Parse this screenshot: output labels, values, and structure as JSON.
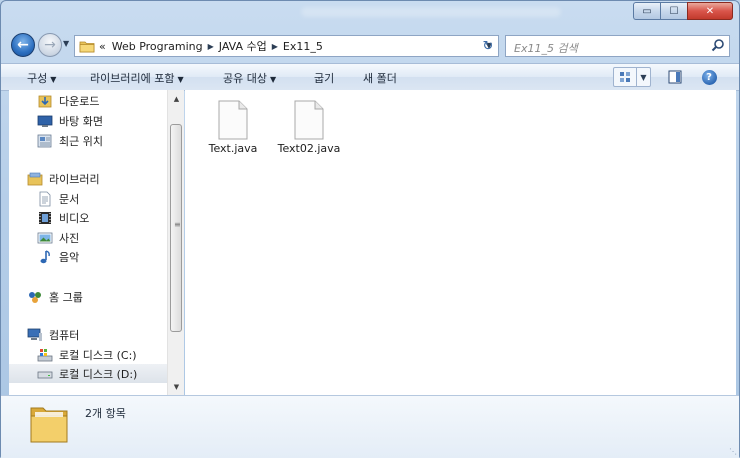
{
  "window": {
    "caption_buttons": {
      "minimize": "▭",
      "maximize": "☐",
      "close": "✕"
    }
  },
  "address": {
    "overflow": "«",
    "crumbs": [
      "Web Programing",
      "JAVA 수업",
      "Ex11_5"
    ],
    "search_placeholder": "Ex11_5 검색"
  },
  "toolbar": {
    "organize": "구성",
    "include_library": "라이브러리에 포함",
    "share_with": "공유 대상",
    "burn": "굽기",
    "new_folder": "새 폴더"
  },
  "navpane": {
    "favorites": [
      {
        "label": "다운로드",
        "icon": "downloads-icon"
      },
      {
        "label": "바탕 화면",
        "icon": "desktop-icon"
      },
      {
        "label": "최근 위치",
        "icon": "recent-places-icon"
      }
    ],
    "libraries": {
      "label": "라이브러리",
      "icon": "library-icon"
    },
    "library_items": [
      {
        "label": "문서",
        "icon": "documents-icon"
      },
      {
        "label": "비디오",
        "icon": "videos-icon"
      },
      {
        "label": "사진",
        "icon": "pictures-icon"
      },
      {
        "label": "음악",
        "icon": "music-icon"
      }
    ],
    "homegroup": {
      "label": "홈 그룹",
      "icon": "homegroup-icon"
    },
    "computer": {
      "label": "컴퓨터",
      "icon": "computer-icon"
    },
    "drives": [
      {
        "label": "로컬 디스크 (C:)",
        "icon": "system-drive-icon"
      },
      {
        "label": "로컬 디스크 (D:)",
        "icon": "drive-icon",
        "selected": true
      }
    ]
  },
  "files": [
    {
      "name": "Text.java"
    },
    {
      "name": "Text02.java"
    }
  ],
  "details": {
    "item_count": "2개 항목"
  }
}
